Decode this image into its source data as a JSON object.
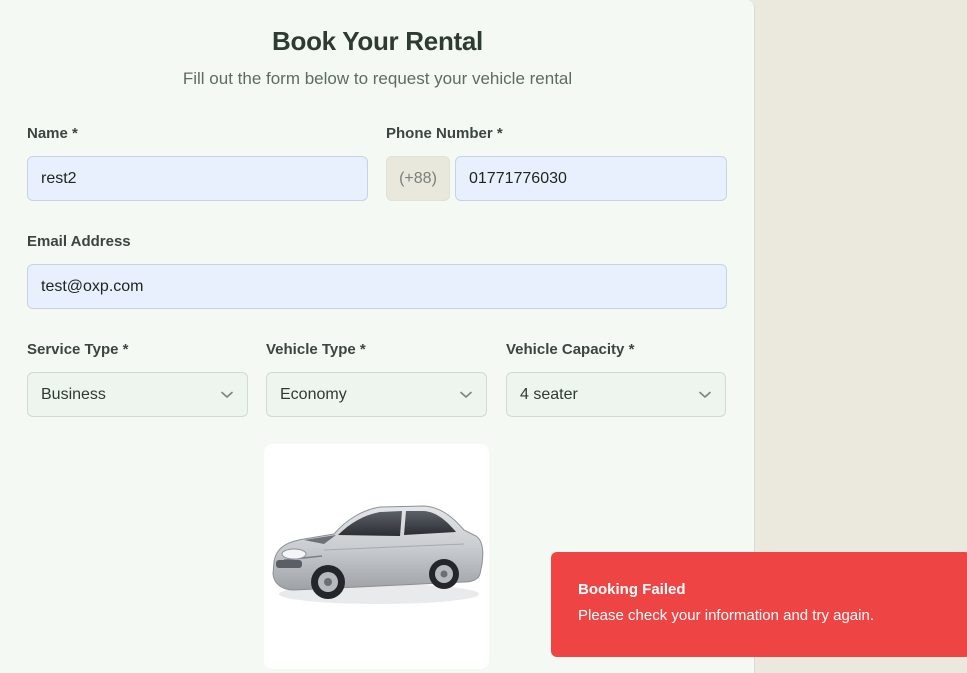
{
  "header": {
    "title": "Book Your Rental",
    "subtitle": "Fill out the form below to request your vehicle rental"
  },
  "form": {
    "name": {
      "label": "Name *",
      "value": "rest2"
    },
    "phone": {
      "label": "Phone Number *",
      "prefix": "(+88)",
      "value": "01771776030"
    },
    "email": {
      "label": "Email Address",
      "value": "test@oxp.com"
    },
    "service_type": {
      "label": "Service Type *",
      "value": "Business"
    },
    "vehicle_type": {
      "label": "Vehicle Type *",
      "value": "Economy"
    },
    "vehicle_capacity": {
      "label": "Vehicle Capacity *",
      "value": "4 seater"
    }
  },
  "vehicle_image": {
    "icon": "sedan-car-image"
  },
  "toast": {
    "title": "Booking Failed",
    "message": "Please check your information and try again.",
    "color": "#ef4444"
  }
}
